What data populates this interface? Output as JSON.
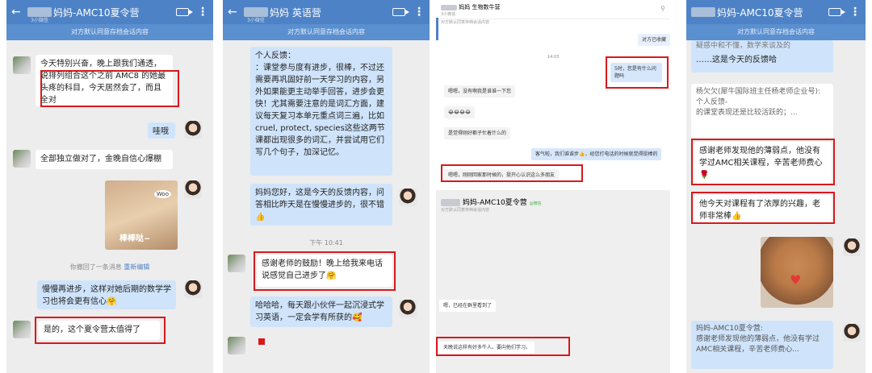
{
  "panel1": {
    "title": "妈妈-AMC10夏令营",
    "subtitle": "3小微信",
    "notice": "对方默认同意存档会话内容",
    "msg1": "今天特别兴奋，晚上跟我们通透，说排列组合这个之前 AMC8 的她最头疼的科目，今天居然会了，而且全对",
    "msg2": "哇哦",
    "msg3": "全部独立做对了，金晚自信心爆棚",
    "sticker_text": "棒棒哒~",
    "sticker_bubble": "Woo",
    "recall_text": "你撤回了一条消息",
    "recall_link": "重新编辑",
    "msg4": "慢慢再进步，这样对她后期的数学学习也将会更有信心🤗",
    "msg5": "是的，这个夏令营太值得了"
  },
  "panel2": {
    "title": "妈妈 英语营",
    "subtitle": "3小微信",
    "notice": "对方默认同意存档会话内容",
    "msg1_heading": "个人反馈：",
    "msg1_body": "：课堂参与度有进步，很棒，不过还需要再巩固好前一天学习的内容，另外如果能更主动举手回答，进步会更快！尤其需要注意的是词汇方面，建议每天复习本单元重点词三遍，比如cruel, protect, species这些这两节课都出现很多的词汇，并尝试用它们写几个句子，加深记忆。",
    "msg2": "妈妈您好，这是今天的反馈内容，问答相比昨天是在慢慢进步的，很不错👍",
    "time": "下午 10:41",
    "msg3": "感谢老师的鼓励！晚上给我来电话说感觉自己进步了🤗",
    "msg4": "哈哈哈，每天跟小伙伴一起沉浸式学习英语，一定会学有所获的🥰"
  },
  "panel3": {
    "title": "妈妈 生物数牛营",
    "subtitle": "3小微信",
    "notice": "对方默认同意存档会话内容",
    "chip": "对方已收藏",
    "time_label": "14:03",
    "msg_out": "5时，您是有什么问题吗",
    "msg_in1": "嗯嗯，没有啊我是谁谁一下您",
    "emoji_row": "😂😂😂😂",
    "msg_in2": "是觉得刚好都子忙着什么的",
    "msg_out2": "客气啦，我们谁谁步👍，经您打电话的时候就觉得挺棒的",
    "msg_in3": "嗯嗯，刚刚回家那时候的，挺开心认识这么多朋友",
    "title2": "妈妈-AMC10夏令营",
    "title2_tag": "@微信",
    "notice2": "对方默认同意存档会话内容",
    "msg_in4": "嗯，已经在群里看到了",
    "msg_in5": "天晚说这样有好多牛人。要向他们学习。"
  },
  "panel4": {
    "title": "妈妈-AMC10夏令营",
    "notice": "对方默认同意存档会话内容",
    "msg0": "……这是今天的反馈哈",
    "msg0_top": "疑惑中和不懂，数学来谈及的",
    "quote_name": "杨欠欠(犀牛国际班主任杨老师企业号):",
    "quote_line1": "个人反馈-",
    "quote_line2": "的课堂表现还是比较活跃的；...",
    "msg1": "感谢老师发现他的薄弱点，他没有学过AMC相关课程，辛苦老师费心🌹",
    "msg2": "他今天对课程有了浓厚的兴趣，老师非常棒👍",
    "quote2_name": "妈妈-AMC10夏令营:",
    "quote2_body": "感谢老师发现他的薄弱点，他没有学过AMC相关课程，辛苦老师费心..."
  }
}
